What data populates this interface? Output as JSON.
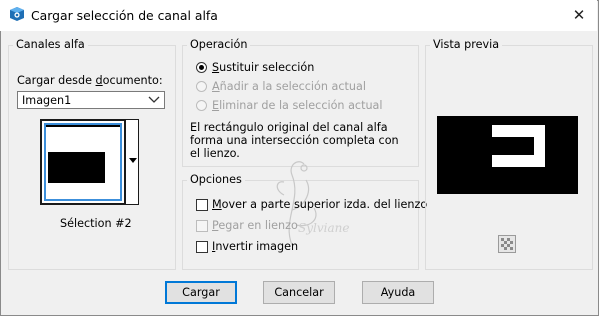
{
  "window": {
    "title": "Cargar selección de canal alfa",
    "close_glyph": "✕"
  },
  "canales": {
    "legend": "Canales alfa",
    "cargar_label": "Cargar desde documento:",
    "select_value": "Imagen1",
    "thumbnail_caption": "Sélection #2"
  },
  "operacion": {
    "legend": "Operación",
    "options": [
      {
        "label": "Sustituir selección",
        "selected": true,
        "enabled": true
      },
      {
        "label": "Añadir a la selección actual",
        "selected": false,
        "enabled": false
      },
      {
        "label": "Eliminar de la selección actual",
        "selected": false,
        "enabled": false
      }
    ],
    "description": [
      "El rectángulo original del canal alfa",
      "forma una intersección completa con",
      "el lienzo."
    ]
  },
  "opciones": {
    "legend": "Opciones",
    "checks": [
      {
        "label": "Mover a parte superior izda. del lienzo",
        "checked": false,
        "enabled": true
      },
      {
        "label": "Pegar en lienzo",
        "checked": false,
        "enabled": false
      },
      {
        "label": "Invertir imagen",
        "checked": false,
        "enabled": true
      }
    ]
  },
  "preview": {
    "legend": "Vista previa"
  },
  "buttons": {
    "cargar": "Cargar",
    "cancelar": "Cancelar",
    "ayuda": "Ayuda"
  },
  "colors": {
    "accent": "#0078d7",
    "window_bg": "#f0f0f0",
    "title_bg": "#ffffff"
  },
  "watermark": {
    "text": "Sylviane"
  }
}
